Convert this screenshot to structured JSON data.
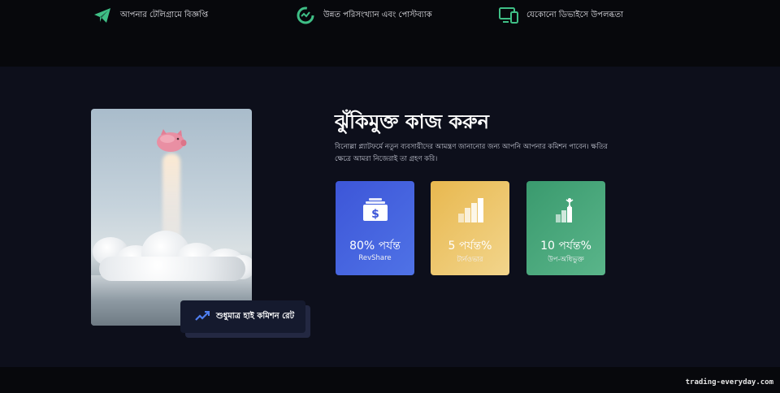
{
  "features": [
    {
      "icon": "telegram-icon",
      "text": "আপনার টেলিগ্রামে বিজ্ঞপ্তি"
    },
    {
      "icon": "stats-refresh-icon",
      "text": "উন্নত পরিসংখ্যান এবং পোস্টব্যাক"
    },
    {
      "icon": "devices-icon",
      "text": "যেকোনো ডিভাইসে উপলব্ধতা"
    }
  ],
  "promo": {
    "heading": "ঝুঁকিমুক্ত কাজ করুন",
    "description": "বিনোল্লা প্ল্যাটফর্মে নতুন ব্যবসায়ীদের আমন্ত্রণ জানানোর জন্য আপনি আপনার কমিশন পাবেন। ক্ষতির ক্ষেত্রে আমরা নিজেরাই তা গ্রহণ করি।",
    "commission_badge": "শুধুমাত্র হাই কমিশন রেট"
  },
  "stats": [
    {
      "icon": "money-stack-icon",
      "value": "80% পর্যন্ত",
      "label": "RevShare",
      "color": "#4662df"
    },
    {
      "icon": "bar-chart-icon",
      "value": "5 পর্যন্ত%",
      "label": "টার্নওভার",
      "color": "#ecc66c"
    },
    {
      "icon": "growth-person-icon",
      "value": "10 পর্যন্ত%",
      "label": "উপ-অধিভুক্ত",
      "color": "#47a77b"
    }
  ],
  "watermark": "trading-everyday.com"
}
